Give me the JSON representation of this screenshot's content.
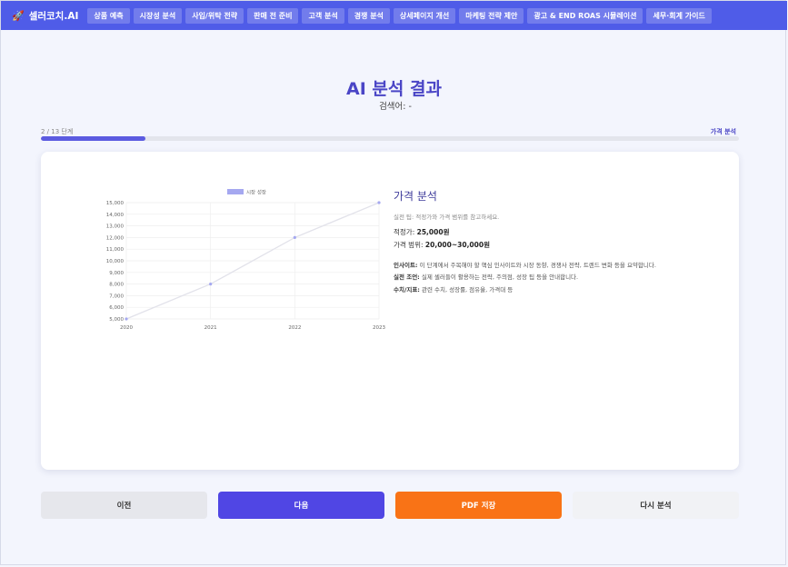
{
  "brand": {
    "icon": "rocket-icon",
    "name": "셀러코치.AI"
  },
  "nav": [
    "상품 예측",
    "시장성 분석",
    "사입/위탁 전략",
    "판매 전 준비",
    "고객 분석",
    "경쟁 분석",
    "상세페이지 개선",
    "마케팅 전략 제안",
    "광고 & END ROAS 시뮬레이션",
    "세무·회계 가이드"
  ],
  "page": {
    "title": "AI 분석 결과",
    "search_label": "검색어:",
    "search_value": "-"
  },
  "progress": {
    "step_text": "2 / 13 단계",
    "current_step": "가격 분석",
    "fraction": 0.15
  },
  "section": {
    "title": "가격 분석",
    "tip": "실전 팁: 적정가와 가격 범위를 참고하세요.",
    "fair_price_label": "적정가:",
    "fair_price_value": "25,000원",
    "range_label": "가격 범위:",
    "range_value": "20,000~30,000원",
    "insight_label": "인사이트:",
    "insight_text": "이 단계에서 주목해야 할 핵심 인사이트와 시장 동향, 경쟁사 전략, 트렌드 변화 등을 요약합니다.",
    "advice_label": "실전 조언:",
    "advice_text": "실제 셀러들이 활용하는 전략, 주의점, 성장 팁 등을 안내합니다.",
    "metrics_label": "수치/지표:",
    "metrics_text": "관련 수치, 성장률, 점유율, 가격대 등"
  },
  "chart_data": {
    "type": "line",
    "x": [
      "2020",
      "2021",
      "2022",
      "2023"
    ],
    "series": [
      {
        "name": "시장 성장",
        "values": [
          5000,
          8000,
          12000,
          15000
        ]
      }
    ],
    "yticks": [
      "5,000",
      "6,000",
      "7,000",
      "8,000",
      "9,000",
      "10,000",
      "11,000",
      "12,000",
      "13,000",
      "14,000",
      "15,000"
    ],
    "ylim": [
      5000,
      15000
    ],
    "grid": true,
    "legend": "top-center",
    "colors": {
      "line": "#e2e2ea",
      "point": "#a5a8f0",
      "legend": "#a5a8f0"
    }
  },
  "buttons": {
    "prev": "이전",
    "next": "다음",
    "pdf": "PDF 저장",
    "redo": "다시 분석"
  },
  "colors": {
    "brand": "#4f5ce8",
    "accent": "#5046e4",
    "pdf": "#f97316",
    "title": "#4a45c6"
  }
}
